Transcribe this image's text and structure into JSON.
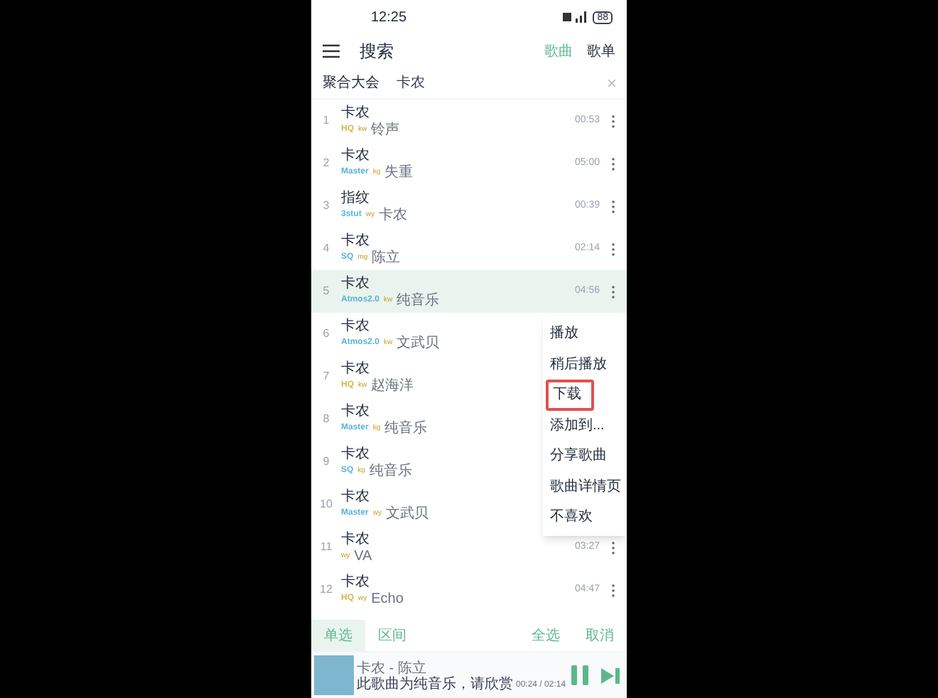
{
  "status_bar": {
    "time": "12:25",
    "battery": "88"
  },
  "header": {
    "title": "搜索",
    "tabs": [
      {
        "label": "歌曲",
        "selected": true
      },
      {
        "label": "歌单",
        "selected": false
      }
    ]
  },
  "search": {
    "source": "聚合大会",
    "value": "卡农"
  },
  "songs": [
    {
      "index": "1",
      "title": "卡农",
      "quality": "HQ",
      "color": "#d4b84a",
      "source": "kw",
      "artist": "铃声",
      "duration": "00:53",
      "selected": false
    },
    {
      "index": "2",
      "title": "卡农",
      "quality": "Master",
      "color": "#5bb4d8",
      "source": "kg",
      "artist": "失重",
      "duration": "05:00",
      "selected": false
    },
    {
      "index": "3",
      "title": "指纹",
      "quality": "3stut",
      "color": "#5bb4d8",
      "source": "wy",
      "artist": "卡农",
      "duration": "00:39",
      "selected": false
    },
    {
      "index": "4",
      "title": "卡农",
      "quality": "SQ",
      "color": "#5bb4d8",
      "source": "mg",
      "artist": "陈立",
      "duration": "02:14",
      "selected": false
    },
    {
      "index": "5",
      "title": "卡农",
      "quality": "Atmos2.0",
      "color": "#5bb4d8",
      "source": "kw",
      "artist": "纯音乐",
      "duration": "04:56",
      "selected": true
    },
    {
      "index": "6",
      "title": "卡农",
      "quality": "Atmos2.0",
      "color": "#5bb4d8",
      "source": "kw",
      "artist": "文武贝",
      "selected": false
    },
    {
      "index": "7",
      "title": "卡农",
      "quality": "HQ",
      "color": "#d4b84a",
      "source": "kw",
      "artist": "赵海洋",
      "selected": false
    },
    {
      "index": "8",
      "title": "卡农",
      "quality": "Master",
      "color": "#5bb4d8",
      "source": "kg",
      "artist": "纯音乐",
      "selected": false
    },
    {
      "index": "9",
      "title": "卡农",
      "quality": "SQ",
      "color": "#5bb4d8",
      "source": "kg",
      "artist": "纯音乐",
      "selected": false
    },
    {
      "index": "10",
      "title": "卡农",
      "quality": "Master",
      "color": "#5bb4d8",
      "source": "wy",
      "artist": "文武贝",
      "selected": false
    },
    {
      "index": "11",
      "title": "卡农",
      "source": "wy",
      "artist": "VA",
      "duration": "03:27",
      "selected": false
    },
    {
      "index": "12",
      "title": "卡农",
      "quality": "HQ",
      "color": "#d4b84a",
      "source": "wy",
      "artist": "Echo",
      "duration": "04:47",
      "selected": false
    }
  ],
  "context_menu": [
    {
      "label": "播放",
      "highlighted": false
    },
    {
      "label": "稍后播放",
      "highlighted": false
    },
    {
      "label": "下载",
      "highlighted": true
    },
    {
      "label": "添加到...",
      "highlighted": false
    },
    {
      "label": "分享歌曲",
      "highlighted": false
    },
    {
      "label": "歌曲详情页",
      "highlighted": false
    },
    {
      "label": "不喜欢",
      "highlighted": false
    }
  ],
  "selection_bar": [
    {
      "label": "单选",
      "selected": true
    },
    {
      "label": "区间",
      "selected": false
    },
    {
      "label": "全选",
      "selected": false
    },
    {
      "label": "取消",
      "selected": false
    }
  ],
  "player": {
    "title": "卡农 - 陈立",
    "lyric": "此歌曲为纯音乐，请欣赏",
    "time": "00:24 / 02:14"
  }
}
